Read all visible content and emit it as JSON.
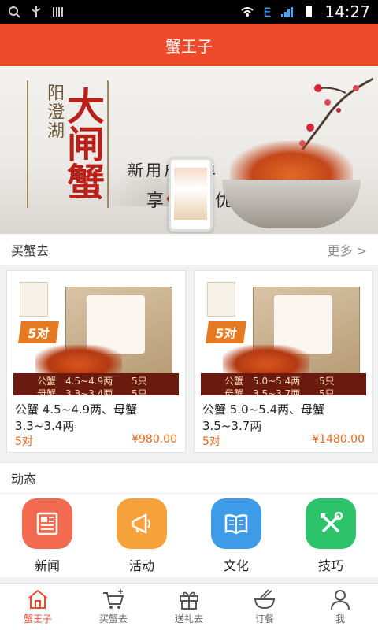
{
  "status_bar": {
    "time": "14:27",
    "network": "E"
  },
  "header": {
    "title": "蟹王子"
  },
  "banner": {
    "vertical_small": "阳澄湖",
    "vertical_big": "大闸蟹",
    "promo_line1": "新用户首单",
    "promo_line2_prefix": "享",
    "promo_line2_amount": "佰",
    "promo_line2_suffix": "元优惠"
  },
  "buy_section": {
    "title": "买蟹去",
    "more": "更多 >"
  },
  "products": [
    {
      "badge": "5对",
      "logo_text": "蟹王子",
      "spec_rows": [
        {
          "k": "公蟹",
          "v": "4.5~4.9两",
          "n": "5只"
        },
        {
          "k": "母蟹",
          "v": "3.3~3.4两",
          "n": "5只"
        }
      ],
      "title": "公蟹 4.5~4.9两、母蟹 3.3~3.4两",
      "pairs": "5对",
      "price": "¥980.00"
    },
    {
      "badge": "5对",
      "logo_text": "蟹王子",
      "spec_rows": [
        {
          "k": "公蟹",
          "v": "5.0~5.4两",
          "n": "5只"
        },
        {
          "k": "母蟹",
          "v": "3.5~3.7两",
          "n": "5只"
        }
      ],
      "title": "公蟹 5.0~5.4两、母蟹 3.5~3.7两",
      "pairs": "5对",
      "price": "¥1480.00"
    }
  ],
  "news_section": {
    "title": "动态"
  },
  "quick_links": [
    {
      "label": "新闻",
      "icon": "newspaper-icon",
      "color": "#f26a4f"
    },
    {
      "label": "活动",
      "icon": "megaphone-icon",
      "color": "#f5a23a"
    },
    {
      "label": "文化",
      "icon": "book-icon",
      "color": "#3d9be8"
    },
    {
      "label": "技巧",
      "icon": "tools-icon",
      "color": "#2cc36b"
    }
  ],
  "tabs": [
    {
      "label": "蟹王子",
      "icon": "home-icon",
      "active": true
    },
    {
      "label": "买蟹去",
      "icon": "cart-icon",
      "active": false
    },
    {
      "label": "送礼去",
      "icon": "gift-icon",
      "active": false
    },
    {
      "label": "订餐",
      "icon": "bowl-icon",
      "active": false
    },
    {
      "label": "我",
      "icon": "user-icon",
      "active": false
    }
  ],
  "colors": {
    "brand": "#f04a2c",
    "price": "#e86a1c"
  }
}
